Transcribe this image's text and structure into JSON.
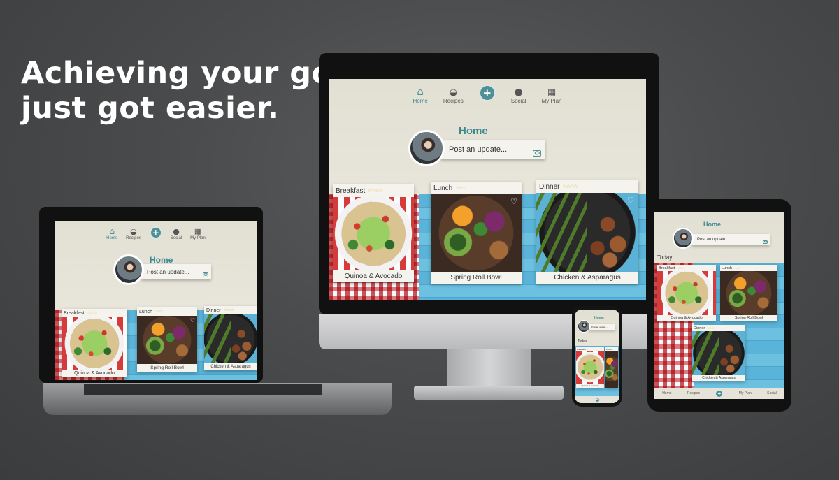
{
  "headline": {
    "line1": "Achieving your goals",
    "line2": "just got easier."
  },
  "app": {
    "nav": {
      "home": "Home",
      "recipes": "Recipes",
      "social": "Social",
      "my_plan": "My Plan",
      "add": "+"
    },
    "home_title": "Home",
    "post_placeholder": "Post an update...",
    "today_label": "Today",
    "meals": {
      "breakfast": {
        "label": "Breakfast",
        "name": "Quinoa & Avocado",
        "stars": "☆☆☆☆"
      },
      "lunch": {
        "label": "Lunch",
        "name": "Spring Roll Bowl",
        "stars": "☆☆☆"
      },
      "dinner": {
        "label": "Dinner",
        "name": "Chicken & Asparagus",
        "stars": "☆☆☆☆"
      }
    },
    "tablet_bottom_nav": [
      "Home",
      "Recipes",
      "+",
      "My Plan",
      "Social"
    ]
  },
  "colors": {
    "accent": "#3d8990",
    "background": "#4a4b4c",
    "screen": "#e2e0d3",
    "stars": "#e1b84a"
  }
}
